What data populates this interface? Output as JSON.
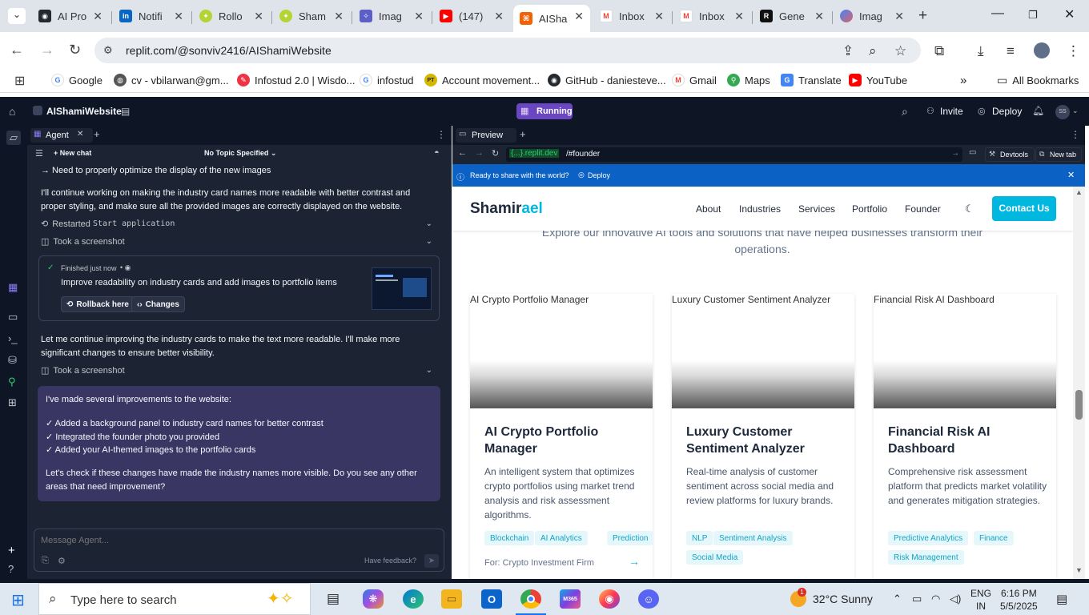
{
  "browser": {
    "tabs": [
      {
        "label": "AI Pro",
        "icon": "github-icon"
      },
      {
        "label": "Notifi",
        "icon": "linkedin-icon"
      },
      {
        "label": "Rollo",
        "icon": "replit-lime-icon"
      },
      {
        "label": "Sham",
        "icon": "replit-lime-icon"
      },
      {
        "label": "Imag",
        "icon": "star-icon"
      },
      {
        "label": "(147)",
        "icon": "youtube-icon"
      },
      {
        "label": "AISha",
        "icon": "replit-icon"
      },
      {
        "label": "Inbox",
        "icon": "gmail-icon"
      },
      {
        "label": "Inbox",
        "icon": "gmail-icon"
      },
      {
        "label": "Gene",
        "icon": "r-icon"
      },
      {
        "label": "Imag",
        "icon": "gemini-icon"
      }
    ],
    "new_tab_symbol": "+",
    "url": "replit.com/@sonviv2416/AIShamiWebsite",
    "bookmarks": [
      {
        "label": "Google"
      },
      {
        "label": "cv - vbilarwan@gm..."
      },
      {
        "label": "Infostud 2.0 | Wisdo..."
      },
      {
        "label": "infostud"
      },
      {
        "label": "Account movement..."
      },
      {
        "label": "GitHub - daniesteve..."
      },
      {
        "label": "Gmail"
      },
      {
        "label": "Maps"
      },
      {
        "label": "Translate"
      },
      {
        "label": "YouTube"
      }
    ],
    "bookmarks_overflow": "»",
    "all_bookmarks": "All Bookmarks"
  },
  "replit": {
    "project_name": "AIShamiWebsite",
    "run_status": "Running",
    "invite": "Invite",
    "deploy": "Deploy",
    "avatar_initials": "SS",
    "agent_tab": "Agent",
    "new_chat": "New chat",
    "topic": "No Topic Specified",
    "messages": {
      "m0": "→ Need to properly optimize the display of the new images",
      "m1": "I'll continue working on making the industry card names more readable with better contrast and proper styling, and make sure all the provided images are correctly displayed on the website.",
      "restart": "Restarted",
      "restart_code": "Start application",
      "screenshot1": "Took a screenshot",
      "card_status": "Finished just now",
      "card_title": "Improve readability on industry cards and add images to portfolio items",
      "rollback": "Rollback here",
      "changes": "Changes",
      "m2": "Let me continue improving the industry cards to make the text more readable. I'll make more significant changes to ensure better visibility.",
      "screenshot2": "Took a screenshot",
      "final_intro": "I've made several improvements to the website:",
      "final_items": [
        "✓ Added a background panel to industry card names for better contrast",
        "✓ Integrated the founder photo you provided",
        "✓ Added your AI-themed images to the portfolio cards"
      ],
      "final_outro": "Let's check if these changes have made the industry names more visible. Do you see any other areas that need improvement?"
    },
    "input_placeholder": "Message Agent...",
    "feedback": "Have feedback?",
    "preview_tab": "Preview",
    "preview_domain": "{...}.replit.dev",
    "preview_path": "/#founder",
    "devtools": "Devtools",
    "new_tab": "New tab",
    "banner_text": "Ready to share with the world?",
    "banner_deploy": "Deploy"
  },
  "site": {
    "logo_a": "Shamir",
    "logo_b": "ael",
    "nav": [
      "About",
      "Industries",
      "Services",
      "Portfolio",
      "Founder"
    ],
    "contact": "Contact Us",
    "intro_line1": "Explore our innovative AI tools and solutions that have helped businesses transform their",
    "intro_line2": "operations.",
    "cards": [
      {
        "alt": "AI Crypto Portfolio Manager",
        "title": "AI Crypto Portfolio Manager",
        "desc": "An intelligent system that optimizes crypto portfolios using market trend analysis and risk assessment algorithms.",
        "tags": [
          "Blockchain",
          "AI Analytics",
          "Prediction"
        ],
        "client": "For: Crypto Investment Firm"
      },
      {
        "alt": "Luxury Customer Sentiment Analyzer",
        "title": "Luxury Customer Sentiment Analyzer",
        "desc": "Real-time analysis of customer sentiment across social media and review platforms for luxury brands.",
        "tags": [
          "NLP",
          "Sentiment Analysis",
          "Social Media"
        ]
      },
      {
        "alt": "Financial Risk AI Dashboard",
        "title": "Financial Risk AI Dashboard",
        "desc": "Comprehensive risk assessment platform that predicts market volatility and generates mitigation strategies.",
        "tags": [
          "Predictive Analytics",
          "Finance",
          "Risk Management"
        ]
      }
    ]
  },
  "taskbar": {
    "search_placeholder": "Type here to search",
    "weather": "32°C  Sunny",
    "weather_badge": "1",
    "lang1": "ENG",
    "lang2": "IN",
    "time": "6:16 PM",
    "date": "5/5/2025",
    "outlook_badge": "",
    "m365": "M365"
  },
  "colors": {
    "accent": "#00b7e0",
    "replit_bg": "#0e1525",
    "agent_bg": "#1c2333",
    "banner": "#0b61c4",
    "running": "#6b46c1"
  }
}
